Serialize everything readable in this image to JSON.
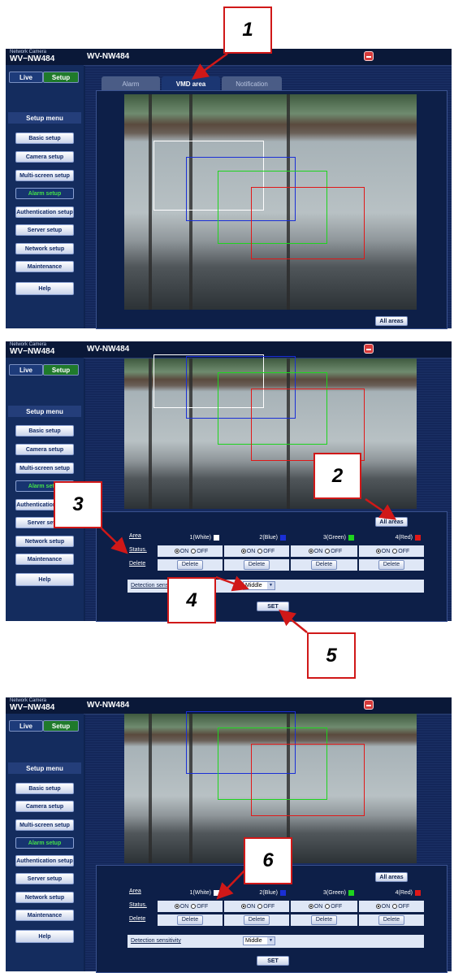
{
  "header": {
    "brand_small": "Network Camera",
    "brand_model": "WV−NW484",
    "model_title": "WV-NW484"
  },
  "nav": {
    "live": "Live",
    "setup": "Setup"
  },
  "menu": {
    "title": "Setup menu",
    "items": [
      "Basic setup",
      "Camera setup",
      "Multi-screen setup",
      "Alarm setup",
      "Authentication setup",
      "Server setup",
      "Network setup",
      "Maintenance"
    ],
    "help": "Help"
  },
  "tabs": [
    "Alarm",
    "VMD area",
    "Notification"
  ],
  "all_areas": "All areas",
  "areas": {
    "header": "Area",
    "status_label": "Status.",
    "delete_label": "Delete",
    "columns": [
      {
        "label": "1(White)",
        "color": "#ffffff"
      },
      {
        "label": "2(Blue)",
        "color": "#1a2fd6"
      },
      {
        "label": "3(Green)",
        "color": "#1ed41e"
      },
      {
        "label": "4(Red)",
        "color": "#e01818"
      }
    ],
    "on": "ON",
    "off": "OFF",
    "delete_button": "Delete"
  },
  "sensitivity": {
    "label": "Detection sensitivity",
    "value": "Middle"
  },
  "set_button": "SET",
  "callouts": [
    "1",
    "2",
    "3",
    "4",
    "5",
    "6"
  ],
  "region_colors": {
    "white": "#ffffff",
    "blue": "#1a2fd6",
    "green": "#1ed41e",
    "red": "#e01818"
  }
}
